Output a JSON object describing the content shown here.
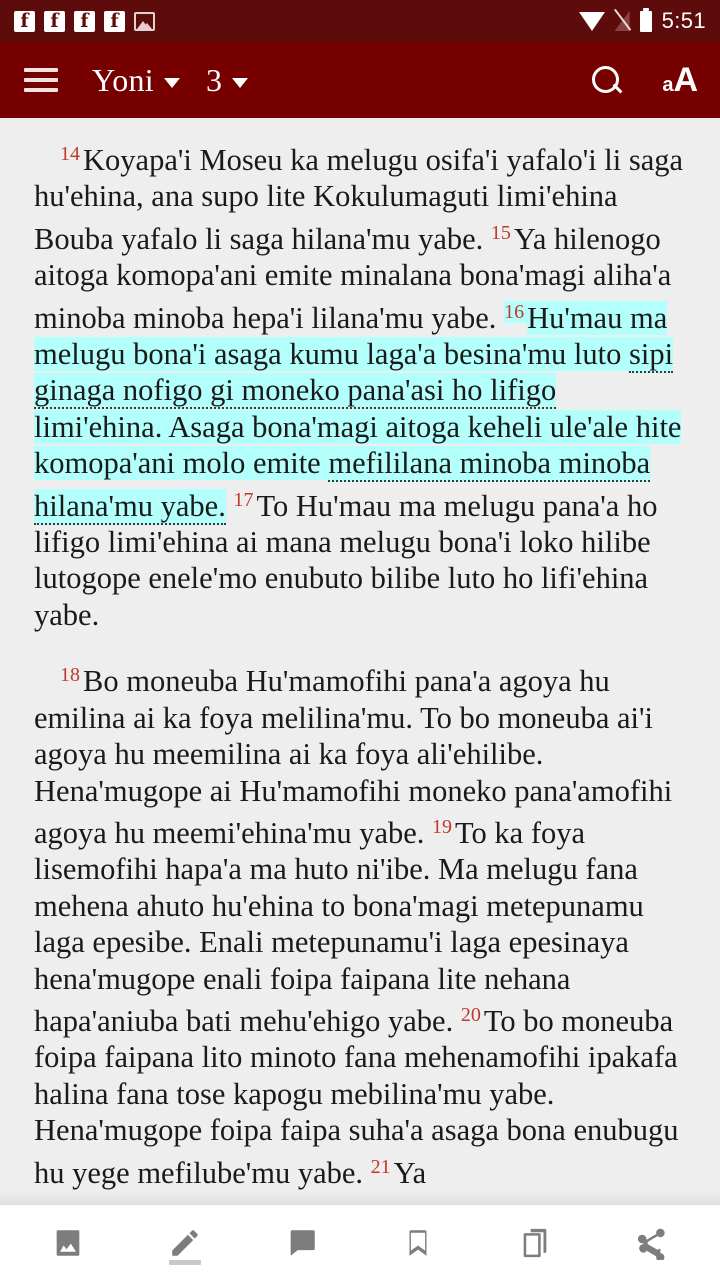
{
  "statusbar": {
    "time": "5:51",
    "icons": [
      "facebook-icon",
      "facebook-icon",
      "facebook-icon",
      "facebook-icon",
      "image-icon",
      "wifi-icon",
      "signal-off-icon",
      "battery-icon"
    ]
  },
  "appbar": {
    "menu_icon": "hamburger-menu-icon",
    "book": "Yoni",
    "chapter": "3",
    "search_icon": "search-icon",
    "textsize_small": "a",
    "textsize_big": "A"
  },
  "reader": {
    "paragraphs": [
      {
        "id": "paragraph-1",
        "verses": [
          {
            "number": "14",
            "segments": [
              {
                "text": "Koyapa'i Moseu ka melugu osifa'i yafalo'i li saga hu'ehina, ana supo lite Kokulumaguti limi'ehina Bouba yafalo li saga hilana'mu yabe.",
                "highlight": false,
                "underline": false
              }
            ]
          },
          {
            "number": "15",
            "segments": [
              {
                "text": "Ya hilenogo aitoga komopa'ani emite minalana bona'magi aliha'a minoba minoba hepa'i lilana'mu yabe.",
                "highlight": false,
                "underline": false
              }
            ]
          },
          {
            "number": "16",
            "highlighted": true,
            "segments": [
              {
                "text": "Hu'mau ma melugu bona'i asaga kumu laga'a besina'mu luto ",
                "highlight": true,
                "underline": false
              },
              {
                "text": "sipi ginaga nofigo gi moneko pana'asi ho lifigo",
                "highlight": true,
                "underline": true
              },
              {
                "text": " limi'ehina. Asaga bona'magi aitoga keheli ule'ale hite komopa'ani molo emite ",
                "highlight": true,
                "underline": false
              },
              {
                "text": "mefililana minoba minoba hilana'mu yabe.",
                "highlight": true,
                "underline": true
              }
            ]
          },
          {
            "number": "17",
            "segments": [
              {
                "text": "To Hu'mau ma melugu pana'a ho lifigo limi'ehina ai mana melugu bona'i loko hilibe lutogope enele'mo enubuto bilibe luto ho lifi'ehina yabe.",
                "highlight": false,
                "underline": false
              }
            ]
          }
        ]
      },
      {
        "id": "paragraph-2",
        "verses": [
          {
            "number": "18",
            "segments": [
              {
                "text": "Bo moneuba Hu'mamofihi pana'a agoya hu emilina ai ka foya melilina'mu. To bo moneuba ai'i agoya hu meemilina ai ka foya ali'ehilibe. Hena'mugope ai Hu'mamofihi moneko pana'amofihi agoya hu meemi'ehina'mu yabe.",
                "highlight": false,
                "underline": false
              }
            ]
          },
          {
            "number": "19",
            "segments": [
              {
                "text": "To ka foya lisemofihi hapa'a ma huto ni'ibe. Ma melugu fana mehena ahuto hu'ehina to bona'magi metepunamu laga epesibe. Enali metepunamu'i laga epesinaya hena'mugope enali foipa faipana lite nehana hapa'aniuba bati mehu'ehigo yabe.",
                "highlight": false,
                "underline": false
              }
            ]
          },
          {
            "number": "20",
            "segments": [
              {
                "text": "To bo moneuba foipa faipana lito minoto fana mehenamofihi ipakafa halina fana tose kapogu mebilina'mu yabe. Hena'mugope foipa faipa suha'a asaga bona enubugu hu yege mefilube'mu yabe.",
                "highlight": false,
                "underline": false
              }
            ]
          },
          {
            "number": "21",
            "segments": [
              {
                "text": "Ya",
                "highlight": false,
                "underline": false
              }
            ]
          }
        ]
      }
    ]
  },
  "bottombar": {
    "items": [
      {
        "name": "image-button",
        "icon": "image-icon",
        "active": false
      },
      {
        "name": "highlight-button",
        "icon": "pencil-icon",
        "active": true
      },
      {
        "name": "note-button",
        "icon": "note-icon",
        "active": false
      },
      {
        "name": "bookmark-button",
        "icon": "bookmark-icon",
        "active": false
      },
      {
        "name": "copy-button",
        "icon": "copy-icon",
        "active": false
      },
      {
        "name": "share-button",
        "icon": "share-icon",
        "active": false
      }
    ]
  },
  "colors": {
    "appbar": "#760000",
    "statusbar": "#5e0b0b",
    "verse_number": "#c0392b",
    "highlight": "#b2fffb",
    "page_background": "#eeeeee"
  }
}
